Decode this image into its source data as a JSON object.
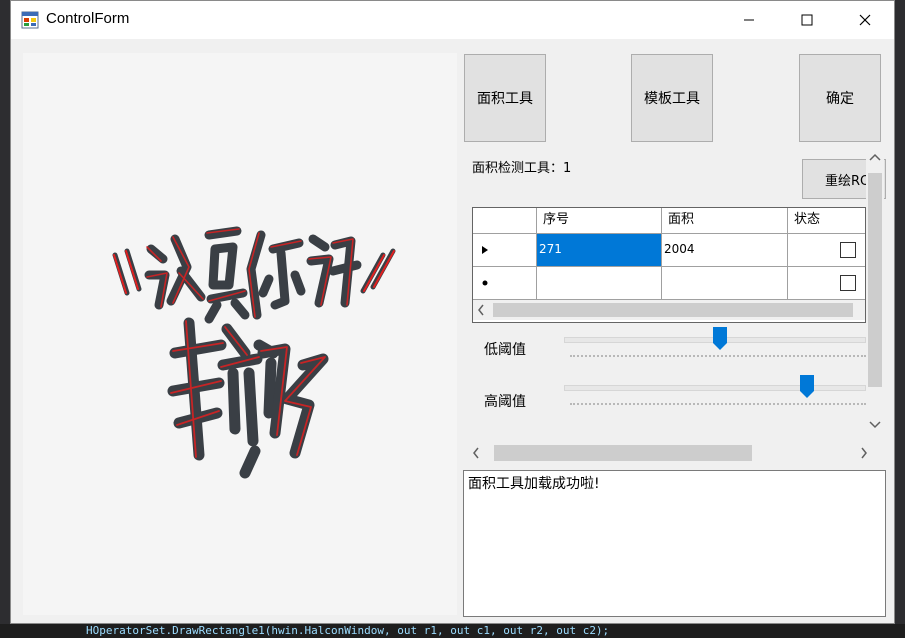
{
  "window": {
    "title": "ControlForm",
    "controls": {
      "minimize": "—",
      "maximize": "☐",
      "close": "✕"
    }
  },
  "image_panel": {
    "content": "calligraphy-image",
    "calligraphy_text": "认真你就输了"
  },
  "toolbar": {
    "area_tool_label": "面积工具",
    "template_tool_label": "模板工具",
    "confirm_label": "确定"
  },
  "tool_panel": {
    "tool_label": "面积检测工具：1",
    "redraw_label": "重绘ROI",
    "grid": {
      "columns": [
        "序号",
        "面积",
        "状态"
      ],
      "rows": [
        {
          "indicator": "▶",
          "index": "271",
          "area": "2004",
          "status_checked": false,
          "selected": true
        },
        {
          "indicator": "*",
          "index": "",
          "area": "",
          "status_checked": false,
          "selected": false
        }
      ]
    },
    "sliders": {
      "low_label": "低阈值",
      "low_value": 0.52,
      "high_label": "高阈值",
      "high_value": 0.81
    }
  },
  "log": {
    "text": "面积工具加载成功啦!"
  },
  "background_code": "HOperatorSet.DrawRectangle1(hwin.HalconWindow, out r1, out c1, out r2, out c2);",
  "colors": {
    "selection": "#0078d7",
    "slider_thumb": "#0078d7",
    "button_face": "#e1e1e1",
    "calligraphy_ink": "#3a3f45",
    "calligraphy_outline": "#e02020"
  }
}
